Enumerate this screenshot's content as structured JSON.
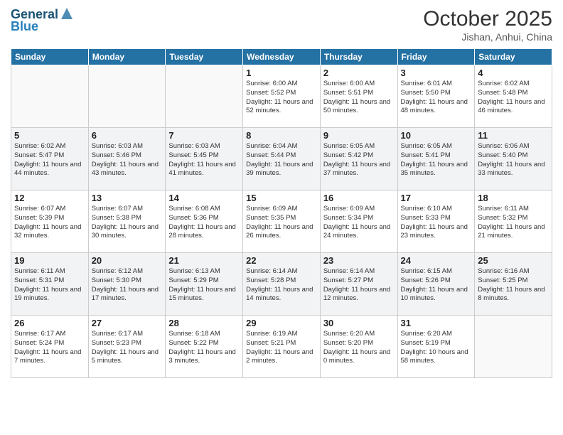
{
  "header": {
    "logo_line1": "General",
    "logo_line2": "Blue",
    "month": "October 2025",
    "location": "Jishan, Anhui, China"
  },
  "weekdays": [
    "Sunday",
    "Monday",
    "Tuesday",
    "Wednesday",
    "Thursday",
    "Friday",
    "Saturday"
  ],
  "weeks": [
    [
      {
        "day": "",
        "info": ""
      },
      {
        "day": "",
        "info": ""
      },
      {
        "day": "",
        "info": ""
      },
      {
        "day": "1",
        "info": "Sunrise: 6:00 AM\nSunset: 5:52 PM\nDaylight: 11 hours and 52 minutes."
      },
      {
        "day": "2",
        "info": "Sunrise: 6:00 AM\nSunset: 5:51 PM\nDaylight: 11 hours and 50 minutes."
      },
      {
        "day": "3",
        "info": "Sunrise: 6:01 AM\nSunset: 5:50 PM\nDaylight: 11 hours and 48 minutes."
      },
      {
        "day": "4",
        "info": "Sunrise: 6:02 AM\nSunset: 5:48 PM\nDaylight: 11 hours and 46 minutes."
      }
    ],
    [
      {
        "day": "5",
        "info": "Sunrise: 6:02 AM\nSunset: 5:47 PM\nDaylight: 11 hours and 44 minutes."
      },
      {
        "day": "6",
        "info": "Sunrise: 6:03 AM\nSunset: 5:46 PM\nDaylight: 11 hours and 43 minutes."
      },
      {
        "day": "7",
        "info": "Sunrise: 6:03 AM\nSunset: 5:45 PM\nDaylight: 11 hours and 41 minutes."
      },
      {
        "day": "8",
        "info": "Sunrise: 6:04 AM\nSunset: 5:44 PM\nDaylight: 11 hours and 39 minutes."
      },
      {
        "day": "9",
        "info": "Sunrise: 6:05 AM\nSunset: 5:42 PM\nDaylight: 11 hours and 37 minutes."
      },
      {
        "day": "10",
        "info": "Sunrise: 6:05 AM\nSunset: 5:41 PM\nDaylight: 11 hours and 35 minutes."
      },
      {
        "day": "11",
        "info": "Sunrise: 6:06 AM\nSunset: 5:40 PM\nDaylight: 11 hours and 33 minutes."
      }
    ],
    [
      {
        "day": "12",
        "info": "Sunrise: 6:07 AM\nSunset: 5:39 PM\nDaylight: 11 hours and 32 minutes."
      },
      {
        "day": "13",
        "info": "Sunrise: 6:07 AM\nSunset: 5:38 PM\nDaylight: 11 hours and 30 minutes."
      },
      {
        "day": "14",
        "info": "Sunrise: 6:08 AM\nSunset: 5:36 PM\nDaylight: 11 hours and 28 minutes."
      },
      {
        "day": "15",
        "info": "Sunrise: 6:09 AM\nSunset: 5:35 PM\nDaylight: 11 hours and 26 minutes."
      },
      {
        "day": "16",
        "info": "Sunrise: 6:09 AM\nSunset: 5:34 PM\nDaylight: 11 hours and 24 minutes."
      },
      {
        "day": "17",
        "info": "Sunrise: 6:10 AM\nSunset: 5:33 PM\nDaylight: 11 hours and 23 minutes."
      },
      {
        "day": "18",
        "info": "Sunrise: 6:11 AM\nSunset: 5:32 PM\nDaylight: 11 hours and 21 minutes."
      }
    ],
    [
      {
        "day": "19",
        "info": "Sunrise: 6:11 AM\nSunset: 5:31 PM\nDaylight: 11 hours and 19 minutes."
      },
      {
        "day": "20",
        "info": "Sunrise: 6:12 AM\nSunset: 5:30 PM\nDaylight: 11 hours and 17 minutes."
      },
      {
        "day": "21",
        "info": "Sunrise: 6:13 AM\nSunset: 5:29 PM\nDaylight: 11 hours and 15 minutes."
      },
      {
        "day": "22",
        "info": "Sunrise: 6:14 AM\nSunset: 5:28 PM\nDaylight: 11 hours and 14 minutes."
      },
      {
        "day": "23",
        "info": "Sunrise: 6:14 AM\nSunset: 5:27 PM\nDaylight: 11 hours and 12 minutes."
      },
      {
        "day": "24",
        "info": "Sunrise: 6:15 AM\nSunset: 5:26 PM\nDaylight: 11 hours and 10 minutes."
      },
      {
        "day": "25",
        "info": "Sunrise: 6:16 AM\nSunset: 5:25 PM\nDaylight: 11 hours and 8 minutes."
      }
    ],
    [
      {
        "day": "26",
        "info": "Sunrise: 6:17 AM\nSunset: 5:24 PM\nDaylight: 11 hours and 7 minutes."
      },
      {
        "day": "27",
        "info": "Sunrise: 6:17 AM\nSunset: 5:23 PM\nDaylight: 11 hours and 5 minutes."
      },
      {
        "day": "28",
        "info": "Sunrise: 6:18 AM\nSunset: 5:22 PM\nDaylight: 11 hours and 3 minutes."
      },
      {
        "day": "29",
        "info": "Sunrise: 6:19 AM\nSunset: 5:21 PM\nDaylight: 11 hours and 2 minutes."
      },
      {
        "day": "30",
        "info": "Sunrise: 6:20 AM\nSunset: 5:20 PM\nDaylight: 11 hours and 0 minutes."
      },
      {
        "day": "31",
        "info": "Sunrise: 6:20 AM\nSunset: 5:19 PM\nDaylight: 10 hours and 58 minutes."
      },
      {
        "day": "",
        "info": ""
      }
    ]
  ]
}
